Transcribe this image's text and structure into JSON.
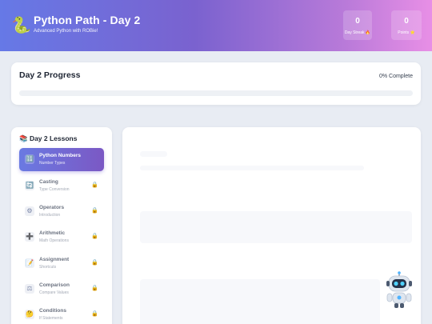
{
  "header": {
    "logo_icon": "snake-icon",
    "title": "Python Path - Day 2",
    "subtitle": "Advanced Python with ROBie!",
    "stats": [
      {
        "value": "0",
        "label": "Day Streak 🔥"
      },
      {
        "value": "0",
        "label": "Points ⭐"
      }
    ]
  },
  "progress": {
    "title": "Day 2 Progress",
    "status": "0% Complete",
    "percent": 0
  },
  "lessons": {
    "heading": "📚 Day 2 Lessons",
    "items": [
      {
        "name": "Python Numbers",
        "sub": "Number Types",
        "icon": "🔢",
        "active": true,
        "locked": false
      },
      {
        "name": "Casting",
        "sub": "Type Conversion",
        "icon": "🔄",
        "active": false,
        "locked": true
      },
      {
        "name": "Operators",
        "sub": "Introduction",
        "icon": "⚙",
        "active": false,
        "locked": true
      },
      {
        "name": "Arithmetic",
        "sub": "Math Operations",
        "icon": "➕",
        "active": false,
        "locked": true
      },
      {
        "name": "Assignment",
        "sub": "Shortcuts",
        "icon": "📝",
        "active": false,
        "locked": true
      },
      {
        "name": "Comparison",
        "sub": "Compare Values",
        "icon": "⚖",
        "active": false,
        "locked": true
      },
      {
        "name": "Conditions",
        "sub": "If Statements",
        "icon": "🤔",
        "active": false,
        "locked": true
      }
    ],
    "lock_icon": "🔒"
  },
  "colors": {
    "header_start": "#6679e6",
    "header_end": "#e88fe6",
    "active_lesson": "#7b58c4",
    "lock": "#e3b341"
  },
  "assistant": {
    "icon": "robot-icon"
  }
}
